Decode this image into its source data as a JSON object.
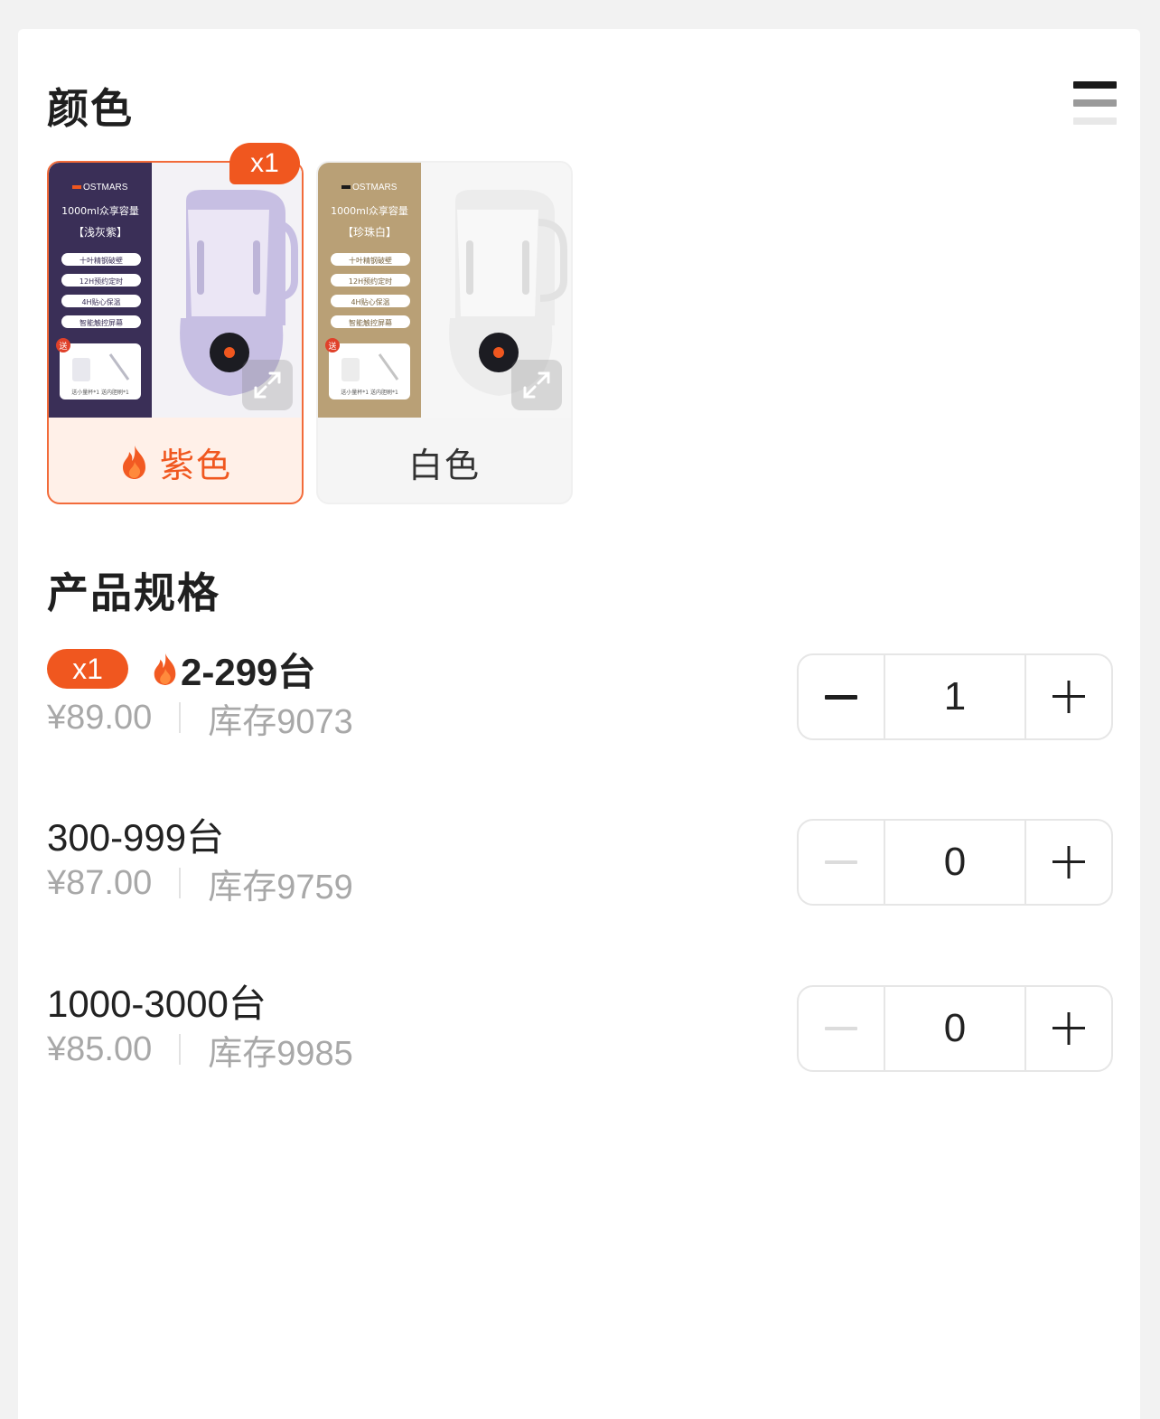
{
  "color_section": {
    "title": "颜色",
    "options": [
      {
        "label": "紫色",
        "selected": true,
        "badge": "x1",
        "hot": true,
        "image": {
          "brand": "OSTMARS",
          "capacity": "1000ml众享容量",
          "variant": "【浅灰紫】",
          "features": [
            "十叶精钢破壁",
            "12H预约定时",
            "4H贴心保温",
            "智能触控屏幕"
          ],
          "gift_badge": "送",
          "gifts": "送小量杯*1  送内胆刷*1",
          "panel_color": "#3a2f57",
          "machine_color": "#c7bfe3"
        }
      },
      {
        "label": "白色",
        "selected": false,
        "badge": "",
        "hot": false,
        "image": {
          "brand": "OSTMARS",
          "capacity": "1000ml众享容量",
          "variant": "【珍珠白】",
          "features": [
            "十叶精钢破壁",
            "12H预约定时",
            "4H贴心保温",
            "智能触控屏幕"
          ],
          "gift_badge": "送",
          "gifts": "送小量杯*1  送内胆刷*1",
          "panel_color": "#b9a076",
          "machine_color": "#ececec"
        }
      }
    ]
  },
  "spec_section": {
    "title": "产品规格",
    "rows": [
      {
        "badge": "x1",
        "hot": true,
        "name": "2-299台",
        "price": "¥89.00",
        "stock": "库存9073",
        "quantity": "1",
        "minus_enabled": true
      },
      {
        "badge": "",
        "hot": false,
        "name": "300-999台",
        "price": "¥87.00",
        "stock": "库存9759",
        "quantity": "0",
        "minus_enabled": false
      },
      {
        "badge": "",
        "hot": false,
        "name": "1000-3000台",
        "price": "¥85.00",
        "stock": "库存9985",
        "quantity": "0",
        "minus_enabled": false
      }
    ]
  },
  "colors": {
    "accent": "#f0571f",
    "muted": "#a8a8a8"
  },
  "icons": [
    "list-view-icon",
    "flame-icon",
    "expand-icon",
    "minus-icon",
    "plus-icon"
  ]
}
